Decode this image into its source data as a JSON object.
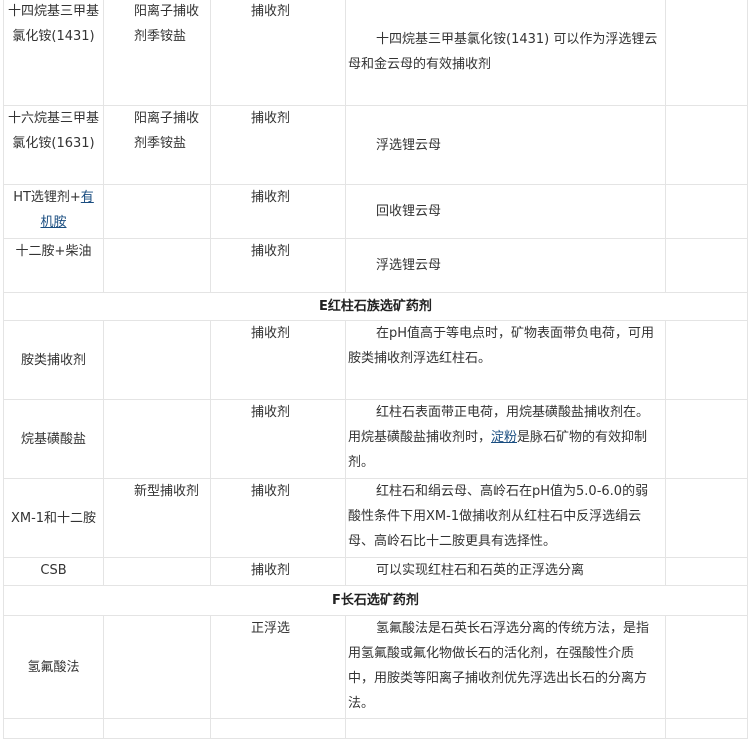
{
  "rows": [
    {
      "name": "十四烷基三甲基氯化铵(1431)",
      "type": "阳离子捕收剂季铵盐",
      "category": "捕收剂",
      "description": "十四烷基三甲基氯化铵(1431) 可以作为浮选锂云母和金云母的有效捕收剂"
    },
    {
      "name": "十六烷基三甲基氯化铵(1631)",
      "type": "阳离子捕收剂季铵盐",
      "category": "捕收剂",
      "description": "浮选锂云母"
    },
    {
      "name_before": "HT选锂剂+",
      "name_link": "有机胺",
      "type": "",
      "category": "捕收剂",
      "description": "回收锂云母"
    },
    {
      "name": "十二胺+柴油",
      "type": "",
      "category": "捕收剂",
      "description": "浮选锂云母"
    },
    {
      "name": "胺类捕收剂",
      "type": "",
      "category": "捕收剂",
      "description": "在pH值高于等电点时，矿物表面带负电荷，可用胺类捕收剂浮选红柱石。"
    },
    {
      "name": "烷基磺酸盐",
      "type": "",
      "category": "捕收剂",
      "desc_before": "红柱石表面带正电荷，用烷基磺酸盐捕收剂在。用烷基磺酸盐捕收剂时，",
      "desc_link": "淀粉",
      "desc_after": "是脉石矿物的有效抑制剂。"
    },
    {
      "name": "XM-1和十二胺",
      "type": "新型捕收剂",
      "category": "捕收剂",
      "description": "红柱石和绢云母、高岭石在pH值为5.0-6.0的弱酸性条件下用XM-1做捕收剂从红柱石中反浮选绢云母、高岭石比十二胺更具有选择性。"
    },
    {
      "name": "CSB",
      "type": "",
      "category": "捕收剂",
      "description": "可以实现红柱石和石英的正浮选分离"
    },
    {
      "name": "氢氟酸法",
      "type": "",
      "category": "正浮选",
      "description": "氢氟酸法是石英长石浮选分离的传统方法，是指用氢氟酸或氟化物做长石的活化剂，在强酸性介质中，用胺类等阳离子捕收剂优先浮选出长石的分离方法。"
    }
  ],
  "sections": {
    "andalusite": "E红柱石族选矿药剂",
    "feldspar": "F长石选矿药剂"
  }
}
